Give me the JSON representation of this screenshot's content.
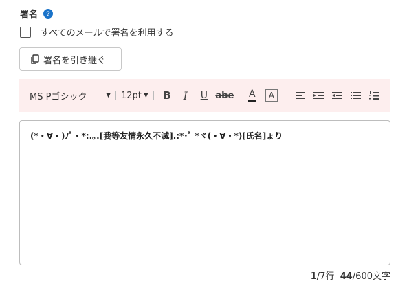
{
  "signature": {
    "title": "署名",
    "help_icon": "?",
    "use_all_label": "すべてのメールで署名を利用する",
    "inherit_button": "署名を引き継ぐ"
  },
  "toolbar": {
    "font_family": "MS Pゴシック",
    "font_size": "12pt",
    "bold": "B",
    "italic": "I",
    "underline": "U",
    "strike": "abe",
    "text_color": "A",
    "highlight": "A"
  },
  "editor": {
    "content": "(*・∀・)ﾉﾟ・*:.｡.[我等友情永久不滅].:*･ﾟ *ヾ(・∀・*)[氏名]ょり"
  },
  "counter": {
    "line_current": "1",
    "line_total": "/7行",
    "char_current": "44",
    "char_total": "/600文字"
  }
}
